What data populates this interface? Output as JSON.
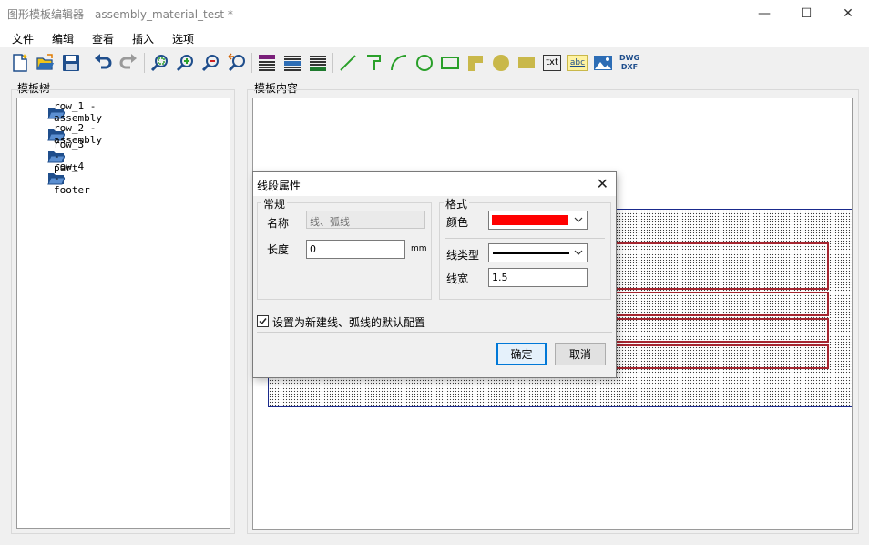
{
  "window": {
    "title": "图形模板编辑器 - assembly_material_test *",
    "minimize": "—",
    "maximize": "☐",
    "close": "✕"
  },
  "menu": {
    "items": [
      "文件",
      "编辑",
      "查看",
      "插入",
      "选项"
    ]
  },
  "toolbar": {
    "dwg_label": "DWG",
    "dxf_label": "DXF",
    "txt_label": "txt",
    "abc_label": "abc"
  },
  "panels": {
    "tree_title": "模板树",
    "content_title": "模板内容"
  },
  "tree": {
    "items": [
      {
        "label": "row_1 - assembly"
      },
      {
        "label": "row_2 - assembly"
      },
      {
        "label": "row_3 - part"
      },
      {
        "label": "row_4 - footer"
      }
    ]
  },
  "dialog": {
    "title": "线段属性",
    "close": "✕",
    "general": {
      "group_title": "常规",
      "name_label": "名称",
      "name_value": "线、弧线",
      "length_label": "长度",
      "length_value": "0",
      "length_unit": "mm"
    },
    "format": {
      "group_title": "格式",
      "color_label": "颜色",
      "color_value": "#ff0000",
      "linetype_label": "线类型",
      "linewidth_label": "线宽",
      "linewidth_value": "1.5"
    },
    "default_checkbox": {
      "label": "设置为新建线、弧线的默认配置",
      "checked": true
    },
    "ok_label": "确定",
    "cancel_label": "取消"
  }
}
